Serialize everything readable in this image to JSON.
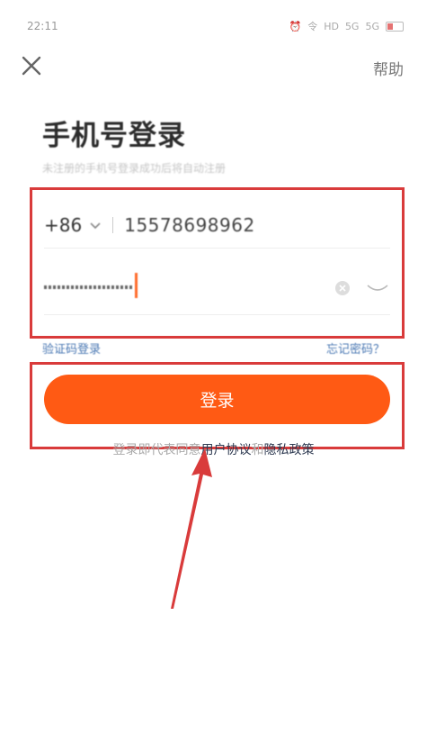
{
  "status_bar": {
    "time": "22:11",
    "icons": [
      "alarm-icon",
      "wifi-icon",
      "hd-signal-icon",
      "signal-5g-icon",
      "signal-5g-icon",
      "battery-icon"
    ],
    "icon_labels": [
      "⏰",
      "令",
      "HD",
      "5G",
      "5G"
    ]
  },
  "header": {
    "close_icon": "close-icon",
    "help_label": "帮助"
  },
  "title": "手机号登录",
  "subtitle": "未注册的手机号登录成功后将自动注册",
  "form": {
    "country_code": "+86",
    "phone_number": "15578698962",
    "password_masked": true
  },
  "links": {
    "sms_login": "验证码登录",
    "forgot_password": "忘记密码？"
  },
  "login_button": "登录",
  "agreement": {
    "prefix": "登录即代表同意",
    "user_agreement": "用户协议",
    "and": "和",
    "privacy_policy": "隐私政策"
  },
  "colors": {
    "accent": "#ff5a14",
    "annotation": "#d93b3b",
    "link": "#4a78b3"
  }
}
